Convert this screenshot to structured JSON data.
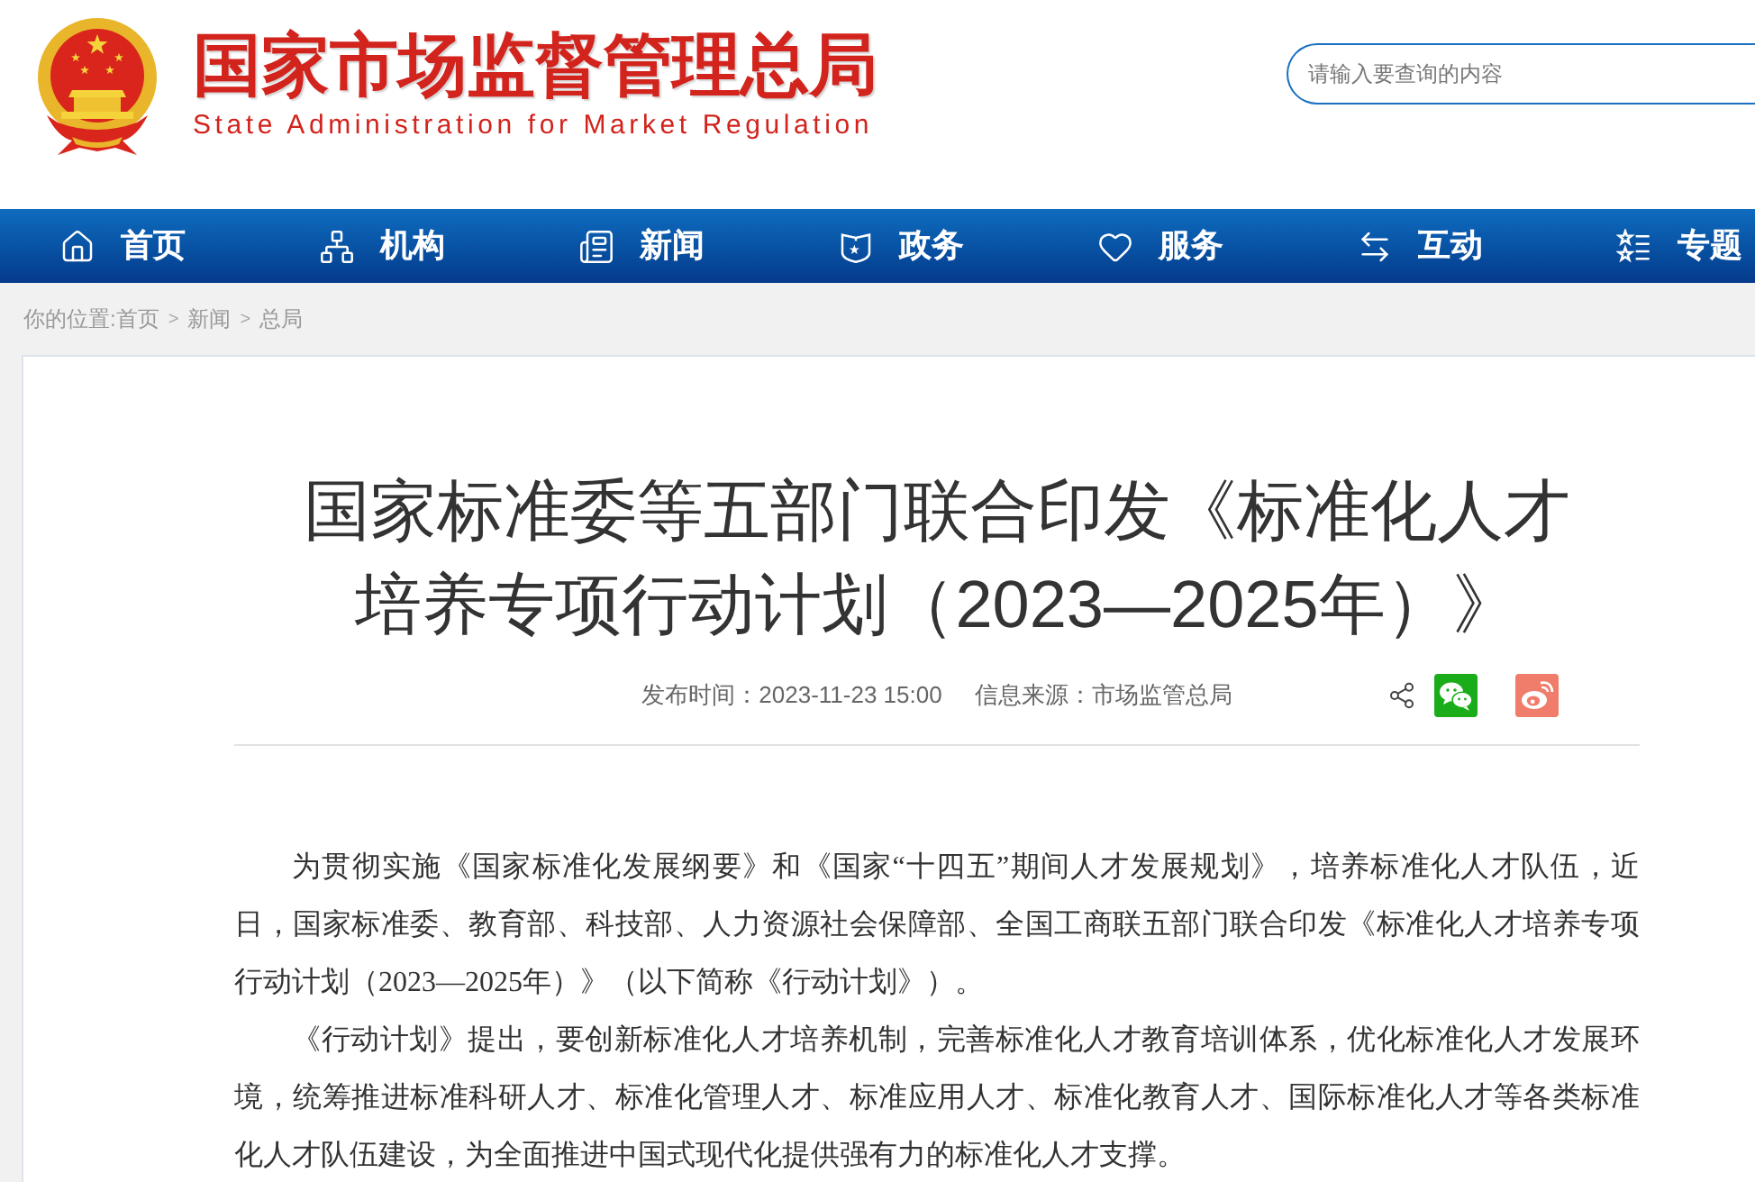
{
  "header": {
    "title": "国家市场监督管理总局",
    "subtitle": "State Administration for Market Regulation",
    "search": {
      "placeholder": "请输入要查询的内容"
    }
  },
  "nav": {
    "items": [
      "首页",
      "机构",
      "新闻",
      "政务",
      "服务",
      "互动",
      "专题"
    ]
  },
  "breadcrumb": {
    "label": "你的位置:",
    "trail": [
      {
        "kind": "link",
        "text": "首页"
      },
      {
        "kind": "separator",
        "text": ">"
      },
      {
        "kind": "link",
        "text": "新闻"
      },
      {
        "kind": "separator",
        "text": ">"
      },
      {
        "kind": "link",
        "text": "总局"
      }
    ]
  },
  "article": {
    "title": "国家标准委等五部门联合印发《标准化人才培养专项行动计划（2023—2025年）》",
    "published": "发布时间：2023-11-23 15:00",
    "source": "信息来源：市场监管总局",
    "paragraphs": [
      "为贯彻实施《国家标准化发展纲要》和《国家“十四五”期间人才发展规划》，培养标准化人才队伍，近日，国家标准委、教育部、科技部、人力资源社会保障部、全国工商联五部门联合印发《标准化人才培养专项行动计划（2023—2025年）》（以下简称《行动计划》）。",
      "《行动计划》提出，要创新标准化人才培养机制，完善标准化人才教育培训体系，优化标准化人才发展环境，统筹推进标准科研人才、标准化管理人才、标准应用人才、标准化教育人才、国际标准化人才等各类标准化人才队伍建设，为全面推进中国式现代化提供强有力的标准化人才支撑。"
    ]
  }
}
